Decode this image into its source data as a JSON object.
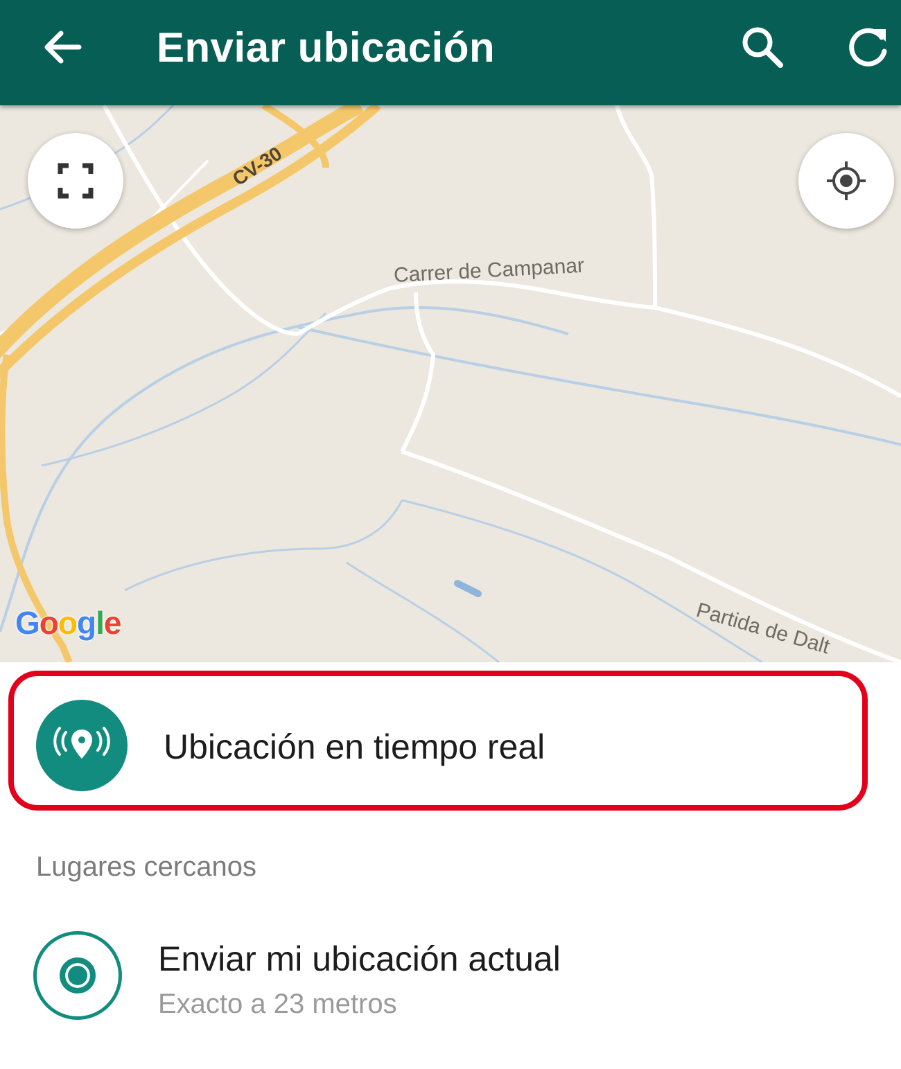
{
  "appbar": {
    "title": "Enviar ubicación",
    "icons": [
      "back-arrow-icon",
      "search-icon",
      "refresh-icon"
    ],
    "background_color": "#075e54"
  },
  "map": {
    "road_labels": {
      "highway": "CV-30",
      "street": "Carrer de Campanar",
      "area": "Partida de Dalt"
    },
    "attribution": {
      "g1": "G",
      "o1": "o",
      "o2": "o",
      "g2": "g",
      "l": "l",
      "e": "e"
    },
    "buttons": [
      "fullscreen-icon",
      "my-location-icon"
    ]
  },
  "live_location": {
    "label": "Ubicación en tiempo real",
    "icon": "live-location-icon",
    "highlight_color": "#e3001b"
  },
  "nearby": {
    "header": "Lugares cercanos"
  },
  "current_location": {
    "label": "Enviar mi ubicación actual",
    "accuracy": "Exacto a 23 metros",
    "icon": "current-location-icon",
    "accent_color": "#128c7e"
  }
}
